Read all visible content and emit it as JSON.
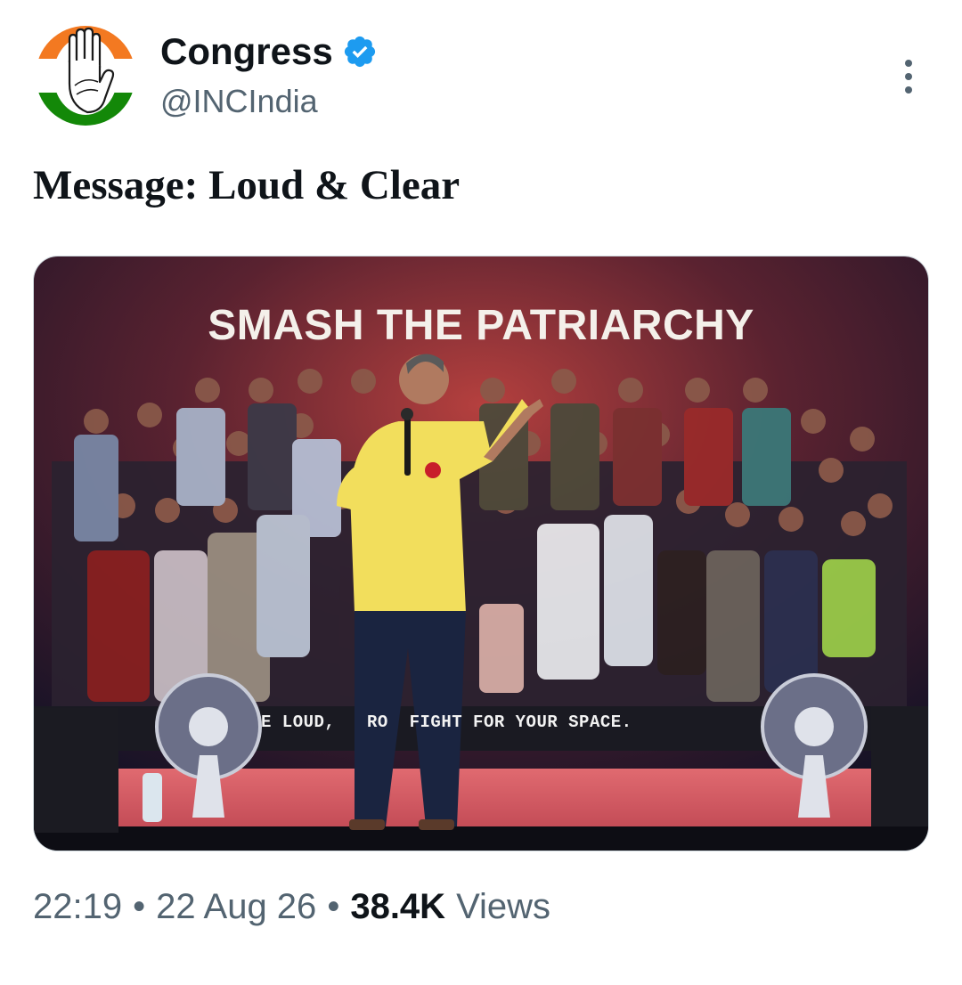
{
  "author": {
    "display_name": "Congress",
    "handle": "@INCIndia",
    "verified": true,
    "verified_color": "#1d9bf0"
  },
  "avatar": {
    "colors": {
      "saffron": "#f37921",
      "white": "#ffffff",
      "green": "#138808",
      "ink": "#1a1a1a"
    }
  },
  "tweet": {
    "text": "Message: Loud & Clear"
  },
  "media": {
    "banner_heading": "SMASH THE PATRIARCHY",
    "banner_tagline": "E LOUD,   RO  FIGHT FOR YOUR SPACE.",
    "colors": {
      "stage_floor": "#d4575f",
      "backdrop_glow": "#b5403e",
      "shirt": "#f2de5c",
      "trousers": "#1a2440"
    }
  },
  "meta": {
    "time": "22:19",
    "separator": "•",
    "date": "22 Aug 26",
    "views_count": "38.4K",
    "views_label": "Views"
  },
  "icons": {
    "verified": "verified-badge-icon",
    "more": "more-options-icon"
  }
}
